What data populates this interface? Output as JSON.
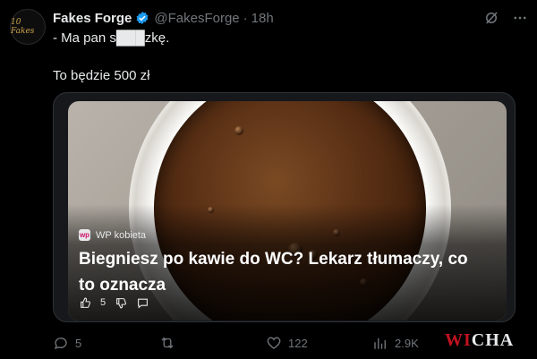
{
  "author": {
    "name": "Fakes Forge",
    "handle": "@FakesForge",
    "time": "18h",
    "avatar_text": "10 Fakes"
  },
  "icons": {
    "verified": "verified-badge-icon",
    "grok": "grok-icon",
    "more": "more-icon"
  },
  "post": {
    "line1": "- Ma pan s███zkę.",
    "line2": "To będzie 500 zł"
  },
  "card": {
    "source": "WP kobieta",
    "source_logo": "wp",
    "headline": "Biegniesz po kawie do WC? Lekarz tłumaczy, co to oznacza",
    "likes": "5"
  },
  "stats": {
    "replies": "5",
    "reposts": "",
    "likes": "122",
    "views": "2.9K"
  },
  "watermark": {
    "part1": "WI",
    "part2": "CHA"
  },
  "colors": {
    "background": "#000000",
    "text": "#e7e9ea",
    "muted": "#71767b",
    "verified": "#1d9bf0",
    "watermark": "#c1121f"
  }
}
